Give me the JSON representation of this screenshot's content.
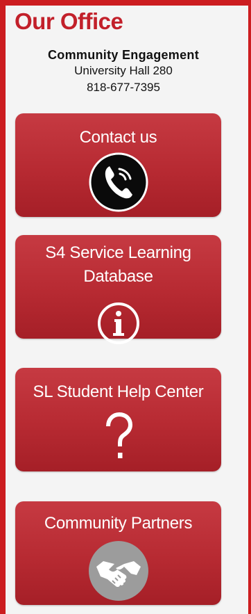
{
  "office": {
    "title": "Our Office",
    "department": "Community Engagement",
    "room": "University Hall 280",
    "phone": "818-677-7395"
  },
  "tiles": [
    {
      "label": "Contact us",
      "icon": "phone-icon"
    },
    {
      "label_line1": "S4 Service Learning",
      "label_line2": "Database",
      "icon": "info-icon"
    },
    {
      "label": "SL Student Help Center",
      "icon": "question-mark-icon"
    },
    {
      "label": "Community Partners",
      "icon": "handshake-icon"
    }
  ],
  "colors": {
    "frame": "#cc1d20",
    "title": "#c2202a",
    "tile": "#b72a32",
    "background": "#f4f4f4"
  }
}
